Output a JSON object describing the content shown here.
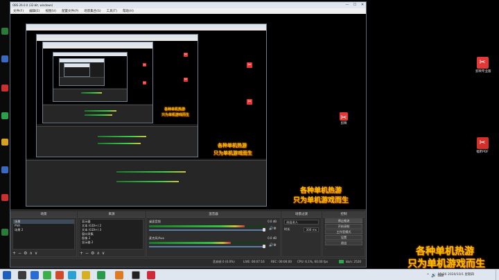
{
  "window": {
    "title": "OBS 26.0.0 (32-bit, windows)",
    "menu": [
      "文件(F)",
      "编辑(E)",
      "视图(V)",
      "配置文件(P)",
      "场景集合(S)",
      "工具(T)",
      "帮助(H)"
    ],
    "controls": [
      "—",
      "☐",
      "✕"
    ]
  },
  "overlay": {
    "line1": "各种单机热游",
    "line2": "只为单机游戏而生",
    "color": "#f0c200"
  },
  "docks": {
    "scenes": {
      "header": "场景",
      "items": [
        "场景",
        "PVA",
        "场景 2"
      ]
    },
    "sources": {
      "header": "来源",
      "items": [
        "显示器",
        "文本 (GDI+) 2",
        "文本 (GDI+) 3",
        "窗口采集",
        "图像 2",
        "显示器 2"
      ]
    },
    "mixer": {
      "header": "混音器",
      "channels": [
        {
          "name": "桌面音频",
          "db": "0.0 dB",
          "level": 0.82
        },
        {
          "name": "麦克风/Aux",
          "db": "0.0 dB",
          "level": 0.7
        }
      ]
    },
    "transitions": {
      "header": "场景过渡",
      "selected": "淡出淡入",
      "duration_label": "时长",
      "duration": "300 ms"
    },
    "controls": {
      "header": "控制",
      "buttons": [
        "停止推流",
        "开始录制",
        "工作室模式",
        "设置",
        "退出"
      ]
    },
    "tools": [
      "+",
      "−",
      "⚙",
      "∧",
      "∨"
    ]
  },
  "status": {
    "dropped": "丢弃帧 0 (0.0%)",
    "live": "LIVE: 00:07:16",
    "rec": "REC: 00:00:00",
    "cpu": "CPU: 6.1%, 60.00 fps",
    "kbps": "kb/s: 2520"
  },
  "desktop_icons": [
    {
      "label": "剪映专业版"
    },
    {
      "label": "剪映"
    },
    {
      "label": "福昕PDF"
    }
  ],
  "taskbar": {
    "clock_time": "15:20",
    "clock_date": "2020/10/1 星期四"
  }
}
